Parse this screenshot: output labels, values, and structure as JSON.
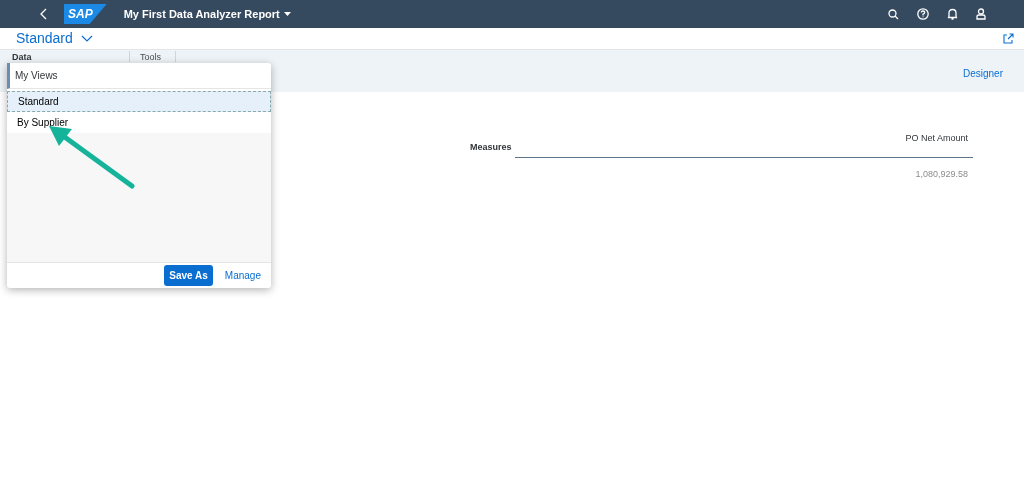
{
  "shell": {
    "title": "My First Data Analyzer Report",
    "logo": "SAP"
  },
  "variant": {
    "label": "Standard"
  },
  "tabs": [
    {
      "label": "Data",
      "selected": true
    },
    {
      "label": "Tools",
      "selected": false
    }
  ],
  "designer": "Designer",
  "popover": {
    "title": "My Views",
    "views": [
      {
        "label": "Standard",
        "selected": true
      },
      {
        "label": "By Supplier",
        "selected": false
      }
    ],
    "buttons": [
      {
        "label": "Save As",
        "kind": "primary"
      },
      {
        "label": "Manage",
        "kind": "link"
      }
    ]
  },
  "table": {
    "row_header": "Measures",
    "columns": [
      "PO Net Amount"
    ],
    "values": [
      "1,080,929.58"
    ]
  }
}
